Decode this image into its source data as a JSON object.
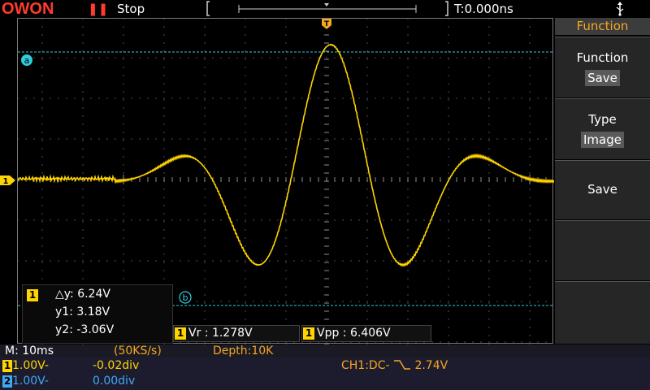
{
  "header": {
    "brand": "OWON",
    "run_icon": "pause-icon",
    "run_state": "Stop",
    "time_offset": "T:0.000ns",
    "usb_icon": "usb-icon"
  },
  "markers": {
    "trigger_top": "T",
    "channel_left": "1",
    "cursor_a": "a",
    "cursor_b": "b"
  },
  "menu": {
    "title": "Function",
    "items": [
      {
        "label": "Function",
        "value": "Save"
      },
      {
        "label": "Type",
        "value": "Image"
      },
      {
        "label": "Save",
        "value": ""
      },
      {
        "label": "",
        "value": ""
      },
      {
        "label": "",
        "value": ""
      }
    ]
  },
  "cursor_info": {
    "channel": "1",
    "dy": "△y: 6.24V",
    "y1": "y1: 3.18V",
    "y2": "y2: -3.06V"
  },
  "measurements": [
    {
      "channel": "1",
      "text": "Vr : 1.278V"
    },
    {
      "channel": "1",
      "text": "Vpp : 6.406V"
    }
  ],
  "status": {
    "timebase": "M: 10ms",
    "sample_rate": "(50KS/s)",
    "depth": "Depth:10K",
    "ch1_tag": "1",
    "ch1_scale": "1.00V-",
    "ch1_pos": "-0.02div",
    "ch2_tag": "2",
    "ch2_scale": "1.00V-",
    "ch2_pos": "0.00div",
    "trigger_prefix": "CH1:DC-",
    "trigger_level": "2.74V"
  },
  "colors": {
    "ch1": "#ffd400",
    "ch2": "#3fa9f5",
    "accent": "#f5a623",
    "cursor": "#33ccdd"
  }
}
